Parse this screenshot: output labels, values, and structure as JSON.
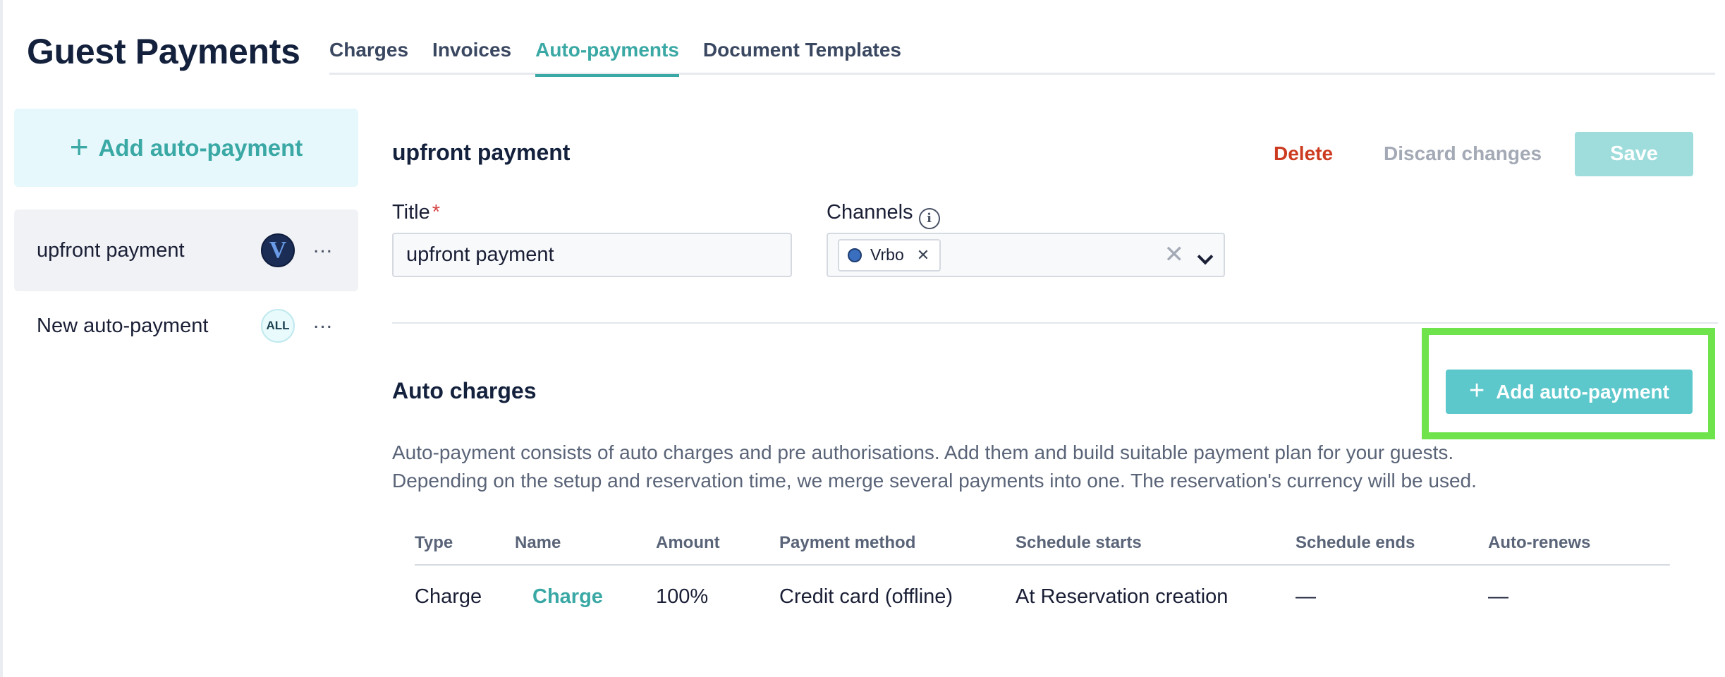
{
  "page": {
    "title": "Guest Payments"
  },
  "tabs": [
    {
      "label": "Charges",
      "active": false
    },
    {
      "label": "Invoices",
      "active": false
    },
    {
      "label": "Auto-payments",
      "active": true
    },
    {
      "label": "Document Templates",
      "active": false
    }
  ],
  "sidebar": {
    "add_button": {
      "label": "Add auto-payment",
      "icon": "plus-icon"
    },
    "items": [
      {
        "label": "upfront payment",
        "badge": "V",
        "selected": true,
        "menu_icon": "more-horizontal-icon"
      },
      {
        "label": "New auto-payment",
        "badge": "ALL",
        "selected": false,
        "menu_icon": "more-horizontal-icon"
      }
    ]
  },
  "editor": {
    "heading": "upfront payment",
    "actions": {
      "delete": "Delete",
      "discard": "Discard changes",
      "save": "Save"
    },
    "title_field": {
      "label": "Title",
      "required_mark": "*",
      "value": "upfront payment"
    },
    "channels_field": {
      "label": "Channels",
      "info_icon": "info-icon",
      "chips": [
        {
          "label": "Vrbo",
          "color": "#3a6fbf"
        }
      ]
    }
  },
  "auto_charges": {
    "heading": "Auto charges",
    "add_button": {
      "label": "Add auto-payment",
      "icon": "plus-icon"
    },
    "description": [
      "Auto-payment consists of auto charges and pre authorisations. Add them and build suitable payment plan for your guests.",
      "Depending on the setup and reservation time, we merge several payments into one. The reservation's currency will be used."
    ],
    "table": {
      "columns": [
        "Type",
        "Name",
        "Amount",
        "Payment method",
        "Schedule starts",
        "Schedule ends",
        "Auto-renews"
      ],
      "rows": [
        [
          "Charge",
          "Charge",
          "100%",
          "Credit card (offline)",
          "At Reservation creation",
          "—",
          "—"
        ]
      ]
    }
  },
  "colors": {
    "accent": "#3aa8a4",
    "danger": "#cc3b1f",
    "highlight": "#6fe34b",
    "title": "#14213d"
  }
}
